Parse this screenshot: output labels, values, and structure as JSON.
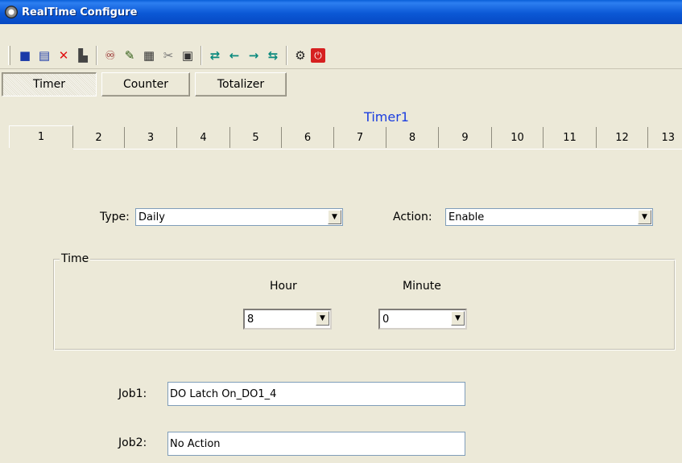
{
  "window": {
    "title": "RealTime Configure"
  },
  "toolbar": {
    "buttons": [
      {
        "name": "save-icon",
        "glyph": "💾"
      },
      {
        "name": "copy-icon",
        "glyph": "🗐"
      },
      {
        "name": "delete-icon",
        "glyph": "✕"
      },
      {
        "name": "print-icon",
        "glyph": "🖶"
      },
      {
        "name": "find-icon",
        "glyph": "🔭"
      },
      {
        "name": "edit-icon",
        "glyph": "✎"
      },
      {
        "name": "calculator-icon",
        "glyph": "▦"
      },
      {
        "name": "tools-icon",
        "glyph": "⚒"
      },
      {
        "name": "document-icon",
        "glyph": "▣"
      },
      {
        "name": "first-icon",
        "glyph": "⇤"
      },
      {
        "name": "previous-icon",
        "glyph": "←"
      },
      {
        "name": "next-icon",
        "glyph": "→"
      },
      {
        "name": "last-icon",
        "glyph": "⇥"
      },
      {
        "name": "settings-icon",
        "glyph": "⚙"
      },
      {
        "name": "stop-icon",
        "glyph": "⏻"
      }
    ]
  },
  "mode_tabs": [
    "Timer",
    "Counter",
    "Totalizer"
  ],
  "panel": {
    "title": "Timer1"
  },
  "number_tabs": [
    "1",
    "2",
    "3",
    "4",
    "5",
    "6",
    "7",
    "8",
    "9",
    "10",
    "11",
    "12",
    "13"
  ],
  "form": {
    "type_label": "Type:",
    "type_value": "Daily",
    "action_label": "Action:",
    "action_value": "Enable",
    "time_legend": "Time",
    "hour_label": "Hour",
    "hour_value": "8",
    "minute_label": "Minute",
    "minute_value": "0",
    "job1_label": "Job1:",
    "job1_value": "DO Latch On_DO1_4",
    "job2_label": "Job2:",
    "job2_value": "No Action"
  },
  "colors": {
    "title_bar": "#0b58d6",
    "panel_title": "#1a3de0"
  }
}
